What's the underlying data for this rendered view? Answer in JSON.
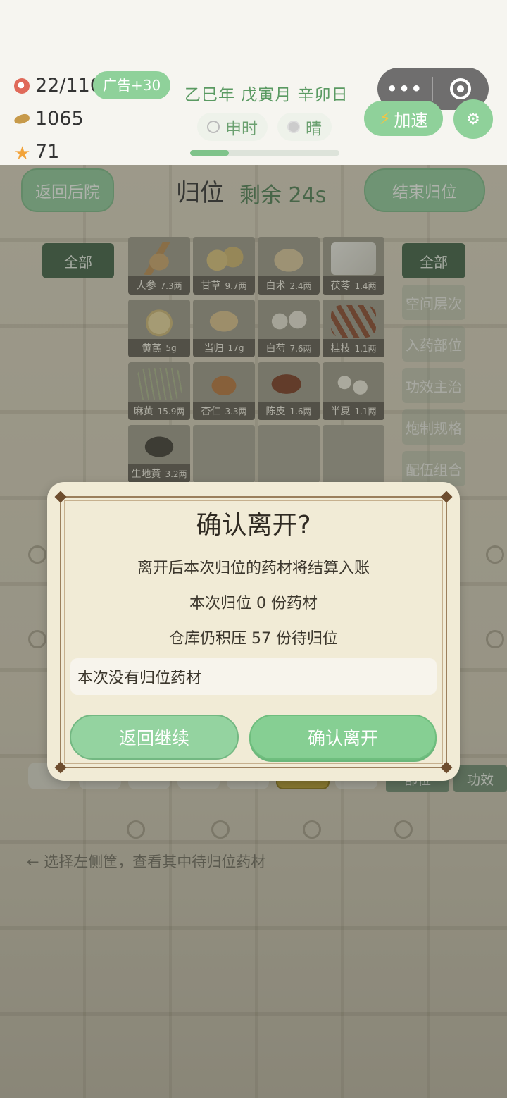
{
  "status": {
    "stamina": "22/110",
    "ad_bonus": "广告+30",
    "coins": "1065",
    "stars": "71"
  },
  "calendar": {
    "date": "乙巳年 戊寅月 辛卯日",
    "hour": "申时",
    "weather": "晴",
    "day_progress": 0.26
  },
  "controls": {
    "speed": "加速"
  },
  "game": {
    "back_label": "返回后院",
    "title": "归位",
    "timer": "剩余 24s",
    "end_label": "结束归位",
    "left_filter": "全部",
    "right_categories": [
      "全部",
      "空间层次",
      "入药部位",
      "功效主治",
      "炮制规格",
      "配伍组合"
    ],
    "herbs": [
      {
        "name": "人参",
        "amount": "7.3两"
      },
      {
        "name": "甘草",
        "amount": "9.7两"
      },
      {
        "name": "白术",
        "amount": "2.4两"
      },
      {
        "name": "茯苓",
        "amount": "1.4两"
      },
      {
        "name": "黄芪",
        "amount": "5g"
      },
      {
        "name": "当归",
        "amount": "17g"
      },
      {
        "name": "白芍",
        "amount": "7.6两"
      },
      {
        "name": "桂枝",
        "amount": "1.1两"
      },
      {
        "name": "麻黄",
        "amount": "15.9两"
      },
      {
        "name": "杏仁",
        "amount": "3.3两"
      },
      {
        "name": "陈皮",
        "amount": "1.6两"
      },
      {
        "name": "半夏",
        "amount": "1.1两"
      },
      {
        "name": "生地黄",
        "amount": "3.2两"
      }
    ],
    "tray_selected_count": "0",
    "bottom_tabs": [
      "部位",
      "功效"
    ],
    "hint": "← 选择左侧筐，查看其中待归位药材"
  },
  "modal": {
    "title": "确认离开?",
    "line1": "离开后本次归位的药材将结算入账",
    "line2": "本次归位 0 份药材",
    "line3": "仓库仍积压 57 份待归位",
    "note": "本次没有归位药材",
    "cancel_label": "返回继续",
    "confirm_label": "确认离开"
  }
}
